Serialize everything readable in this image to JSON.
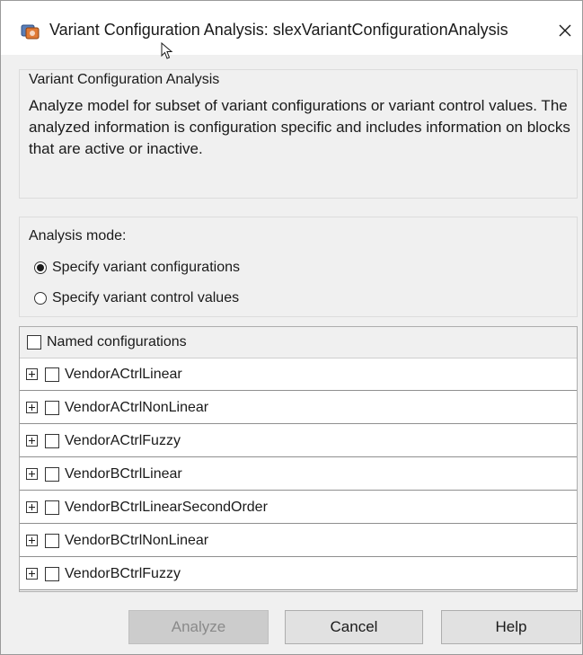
{
  "window": {
    "title": "Variant Configuration Analysis: slexVariantConfigurationAnalysis",
    "app_icon": "simulink-model-icon",
    "close_symbol": "✕"
  },
  "description": {
    "title": "Variant Configuration Analysis",
    "body": "Analyze model for subset of variant configurations or variant control values. The analyzed information is configuration specific and includes information on blocks that are active or inactive."
  },
  "analysis_mode": {
    "label": "Analysis mode:",
    "options": [
      {
        "label": "Specify variant configurations",
        "selected": true
      },
      {
        "label": "Specify variant control values",
        "selected": false
      }
    ]
  },
  "configurations": {
    "header_label": "Named configurations",
    "header_checked": false,
    "items": [
      {
        "label": "VendorACtrlLinear",
        "checked": false,
        "expandable": true
      },
      {
        "label": "VendorACtrlNonLinear",
        "checked": false,
        "expandable": true
      },
      {
        "label": "VendorACtrlFuzzy",
        "checked": false,
        "expandable": true
      },
      {
        "label": "VendorBCtrlLinear",
        "checked": false,
        "expandable": true
      },
      {
        "label": "VendorBCtrlLinearSecondOrder",
        "checked": false,
        "expandable": true
      },
      {
        "label": "VendorBCtrlNonLinear",
        "checked": false,
        "expandable": true
      },
      {
        "label": "VendorBCtrlFuzzy",
        "checked": false,
        "expandable": true
      }
    ]
  },
  "buttons": {
    "analyze": {
      "label": "Analyze",
      "enabled": false
    },
    "cancel": {
      "label": "Cancel",
      "enabled": true
    },
    "help": {
      "label": "Help",
      "enabled": true
    }
  }
}
